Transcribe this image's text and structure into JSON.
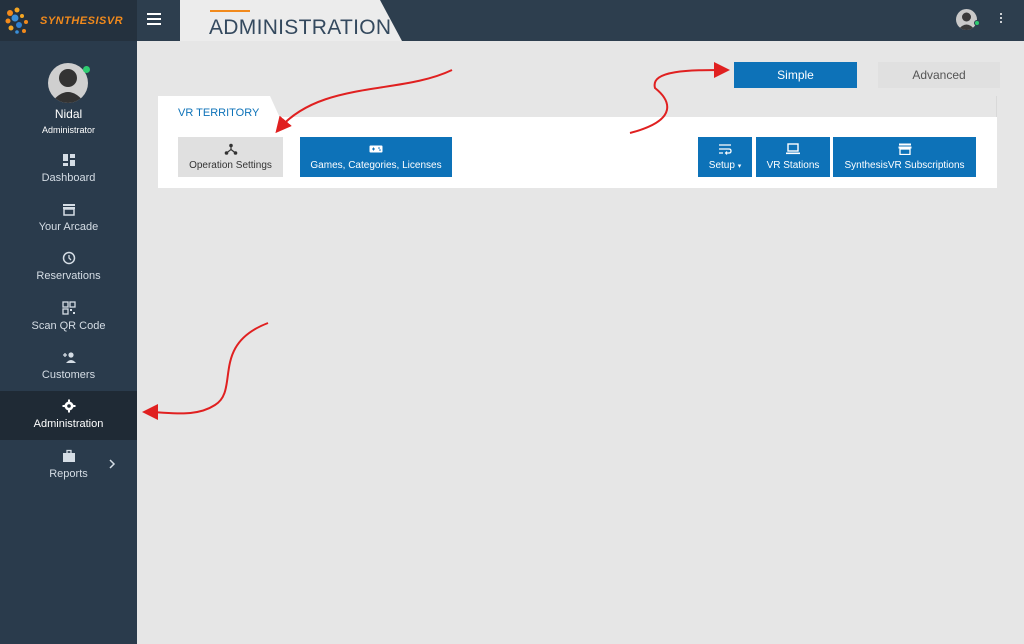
{
  "header": {
    "brand": "SYNTHESISVR",
    "page_title": "ADMINISTRATION"
  },
  "profile": {
    "name": "Nidal",
    "role": "Administrator"
  },
  "sidebar": {
    "items": [
      {
        "label": "Dashboard",
        "icon": "dashboard-icon"
      },
      {
        "label": "Your Arcade",
        "icon": "store-icon"
      },
      {
        "label": "Reservations",
        "icon": "clock-icon"
      },
      {
        "label": "Scan QR Code",
        "icon": "qr-code-icon"
      },
      {
        "label": "Customers",
        "icon": "add-person-icon"
      },
      {
        "label": "Administration",
        "icon": "gear-icon",
        "active": true
      },
      {
        "label": "Reports",
        "icon": "briefcase-icon",
        "has_submenu": true
      }
    ]
  },
  "mode": {
    "simple": "Simple",
    "advanced": "Advanced",
    "selected": "Simple"
  },
  "panel": {
    "tab_label": "VR TERRITORY",
    "buttons": {
      "operation_settings": "Operation Settings",
      "games": "Games, Categories, Licenses",
      "setup": "Setup",
      "vr_stations": "VR Stations",
      "subscriptions": "SynthesisVR Subscriptions"
    }
  },
  "colors": {
    "topbar": "#2d3e4e",
    "sidebar": "#2a3b4c",
    "accent_blue": "#0d72b8",
    "brand_orange": "#f28a1c",
    "annotation_red": "#e02020"
  }
}
